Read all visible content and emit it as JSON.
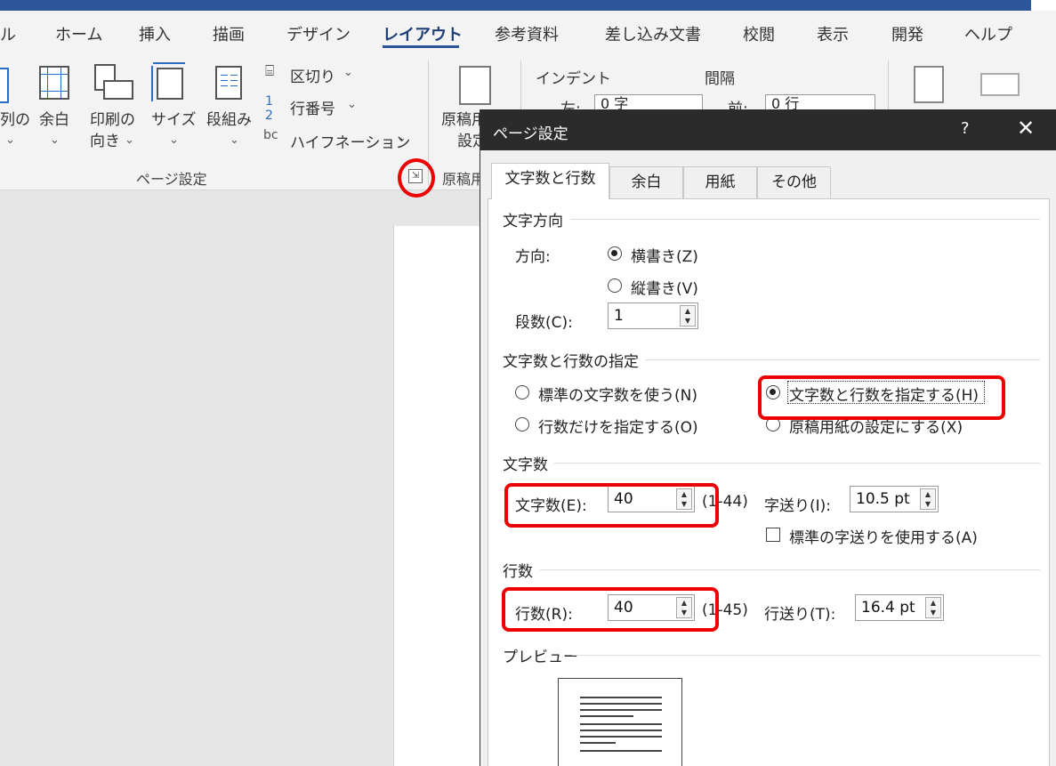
{
  "ribbon": {
    "tabs": [
      {
        "label": "ル"
      },
      {
        "label": "ホーム"
      },
      {
        "label": "挿入"
      },
      {
        "label": "描画"
      },
      {
        "label": "デザイン"
      },
      {
        "label": "レイアウト"
      },
      {
        "label": "参考資料"
      },
      {
        "label": "差し込み文書"
      },
      {
        "label": "校閲"
      },
      {
        "label": "表示"
      },
      {
        "label": "開発"
      },
      {
        "label": "ヘルプ"
      }
    ],
    "buttons": {
      "direction_partial": "列の",
      "margins": "余白",
      "orientation_l1": "印刷の",
      "orientation_l2": "向き",
      "size": "サイズ",
      "columns": "段組み",
      "manuscript_l1": "原稿用",
      "manuscript_l2": "設定"
    },
    "small": {
      "breaks": "区切り",
      "line_numbers": "行番号",
      "hyphenation": "ハイフネーション"
    },
    "groups": {
      "page_setup": "ページ設定",
      "manuscript": "原稿用"
    },
    "paragraph": {
      "indent_label": "インデント",
      "spacing_label": "間隔",
      "left_label": "左:",
      "left_value": "0 字",
      "before_label": "前:",
      "before_value": "0 行"
    }
  },
  "dialog": {
    "title": "ページ設定",
    "help": "?",
    "close": "✕",
    "tabs": [
      {
        "label": "文字数と行数"
      },
      {
        "label": "余白"
      },
      {
        "label": "用紙"
      },
      {
        "label": "その他"
      }
    ],
    "text_direction": {
      "section": "文字方向",
      "direction_label": "方向:",
      "horizontal": "横書き(Z)",
      "vertical": "縦書き(V)",
      "columns_label": "段数(C):",
      "columns_value": "1"
    },
    "grid": {
      "section": "文字数と行数の指定",
      "standard": "標準の文字数を使う(N)",
      "specify_both": "文字数と行数を指定する(H)",
      "lines_only": "行数だけを指定する(O)",
      "manuscript": "原稿用紙の設定にする(X)"
    },
    "chars": {
      "section": "文字数",
      "label": "文字数(E):",
      "value": "40",
      "range": "(1-44)",
      "pitch_label": "字送り(I):",
      "pitch_value": "10.5 pt",
      "use_standard_pitch": "標準の字送りを使用する(A)"
    },
    "lines": {
      "section": "行数",
      "label": "行数(R):",
      "value": "40",
      "range": "(1-45)",
      "pitch_label": "行送り(T):",
      "pitch_value": "16.4 pt"
    },
    "preview": {
      "section": "プレビュー"
    }
  }
}
